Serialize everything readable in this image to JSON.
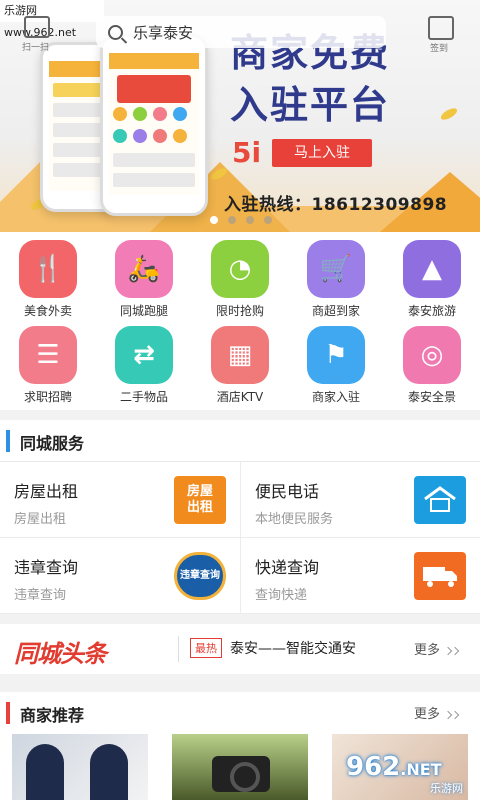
{
  "watermark": {
    "site": "乐游网 www.962.net",
    "logo": "962",
    "logo_suffix": ".NET",
    "logo_sub": "乐游网"
  },
  "topbar": {
    "back_label": "扫一扫",
    "search_text": "乐享泰安",
    "checkin_label": "签到"
  },
  "banner": {
    "headline_line1": "商家免费",
    "headline_line2": "入驻平台",
    "brand": "5i",
    "join_button": "马上入驻",
    "hotline": "入驻热线：18612309898",
    "slide_count": 4,
    "active_slide": 0
  },
  "categories": [
    {
      "label": "美食外卖",
      "icon": "fork-knife-icon",
      "color": "#f2666a"
    },
    {
      "label": "同城跑腿",
      "icon": "scooter-icon",
      "color": "#f27cb5"
    },
    {
      "label": "限时抢购",
      "icon": "clock-icon",
      "color": "#8ccf3f"
    },
    {
      "label": "商超到家",
      "icon": "cart-icon",
      "color": "#9c7ee8"
    },
    {
      "label": "泰安旅游",
      "icon": "landscape-icon",
      "color": "#8f6ee0"
    },
    {
      "label": "求职招聘",
      "icon": "document-icon",
      "color": "#f27c8a"
    },
    {
      "label": "二手物品",
      "icon": "exchange-icon",
      "color": "#35c9b6"
    },
    {
      "label": "酒店KTV",
      "icon": "building-icon",
      "color": "#f07a7a"
    },
    {
      "label": "商家入驻",
      "icon": "tag-icon",
      "color": "#3fa8f0"
    },
    {
      "label": "泰安全景",
      "icon": "panorama-icon",
      "color": "#f07ab0"
    }
  ],
  "services_section": {
    "title": "同城服务"
  },
  "services": [
    {
      "title": "房屋出租",
      "subtitle": "房屋出租",
      "badge": "房屋\n出租",
      "badge_color": "#f28b1e"
    },
    {
      "title": "便民电话",
      "subtitle": "本地便民服务",
      "badge": "",
      "badge_color": "#1b9de0"
    },
    {
      "title": "违章查询",
      "subtitle": "违章查询",
      "badge": "违章查询",
      "badge_color": "#1a5ea8"
    },
    {
      "title": "快递查询",
      "subtitle": "查询快递",
      "badge": "",
      "badge_color": "#f26b22"
    }
  ],
  "news": {
    "logo": "同城头条",
    "hot_tag": "最热",
    "headline": "泰安——智能交通安",
    "more": "更多"
  },
  "merchants": {
    "title": "商家推荐",
    "more": "更多"
  }
}
